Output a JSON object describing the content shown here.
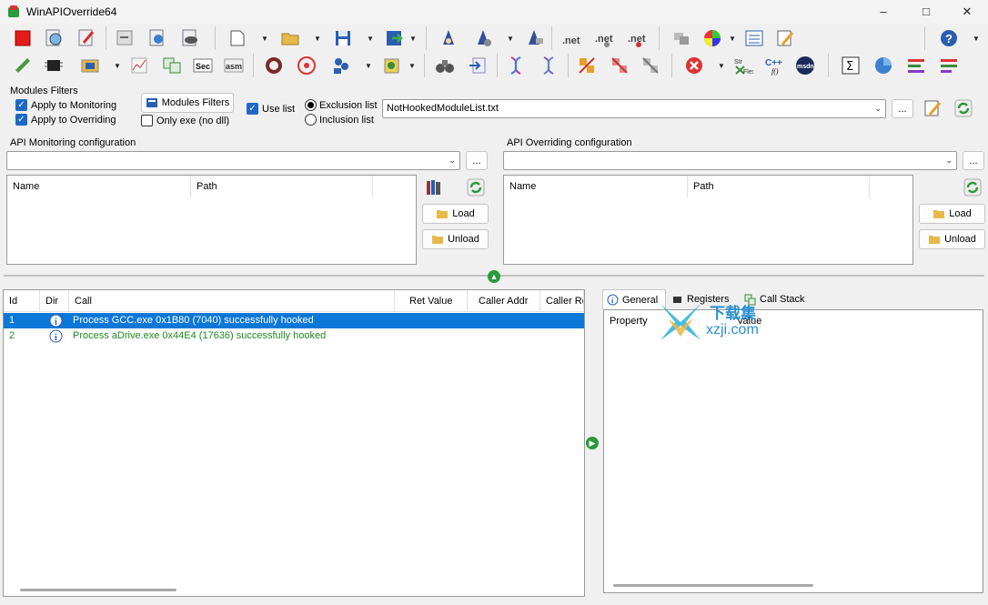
{
  "window": {
    "title": "WinAPIOverride64"
  },
  "modules_filters": {
    "group_label": "Modules Filters",
    "apply_monitoring": "Apply to Monitoring",
    "apply_overriding": "Apply to Overriding",
    "modules_filters_button": "Modules Filters",
    "only_exe": "Only exe (no dll)",
    "use_list": "Use list",
    "exclusion_list": "Exclusion list",
    "inclusion_list": "Inclusion list",
    "list_file": "NotHookedModuleList.txt",
    "browse_label": "..."
  },
  "monitoring": {
    "group_label": "API Monitoring configuration",
    "combo_value": "",
    "browse_label": "...",
    "columns": [
      "Name",
      "Path"
    ],
    "load_label": "Load",
    "unload_label": "Unload"
  },
  "overriding": {
    "group_label": "API Overriding configuration",
    "combo_value": "",
    "browse_label": "...",
    "columns": [
      "Name",
      "Path"
    ],
    "load_label": "Load",
    "unload_label": "Unload"
  },
  "log": {
    "columns": [
      "Id",
      "Dir",
      "Call",
      "Ret Value",
      "Caller Addr",
      "Caller Re"
    ],
    "rows": [
      {
        "id": "1",
        "call": "Process GCC.exe 0x1B80 (7040) successfully hooked",
        "selected": true
      },
      {
        "id": "2",
        "call": "Process aDrive.exe 0x44E4 (17636) successfully hooked",
        "selected": false
      }
    ]
  },
  "detail": {
    "tabs": [
      "General",
      "Registers",
      "Call Stack"
    ],
    "columns": [
      "Property",
      "Value"
    ]
  },
  "watermark": {
    "top": "下载集",
    "bottom": "xzji.com"
  },
  "colors": {
    "selection": "#0b78d7",
    "success_text": "#1e8a1e",
    "accent_green": "#2a9a3a"
  }
}
